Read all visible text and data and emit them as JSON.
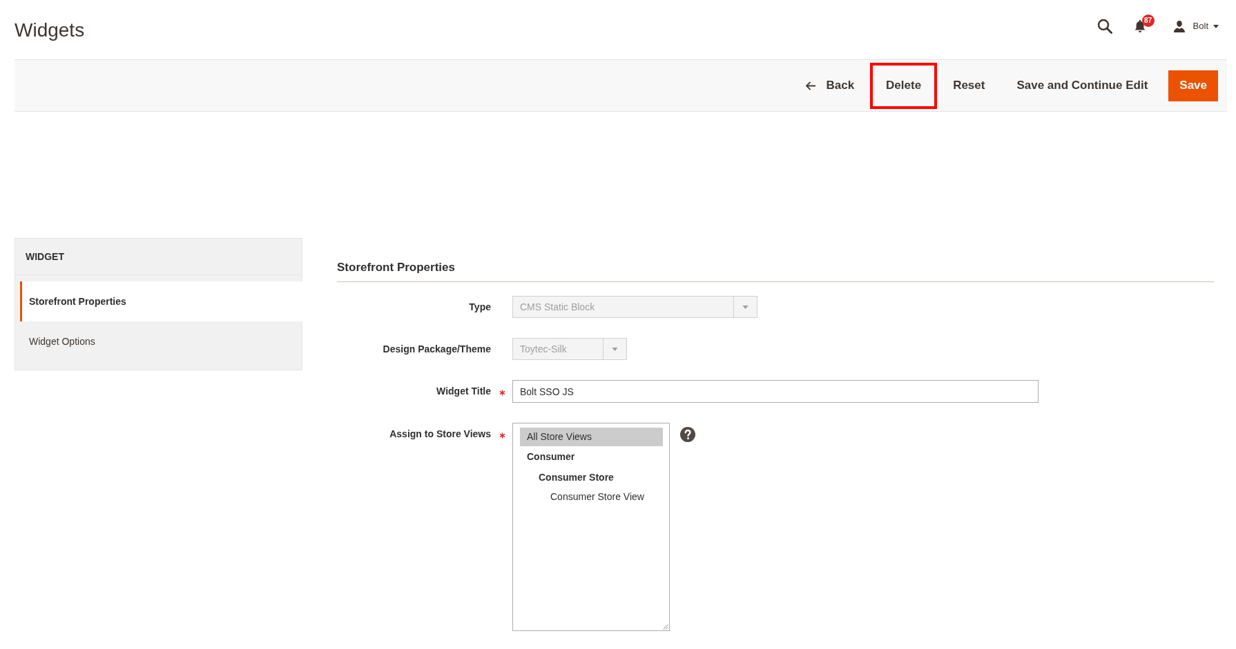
{
  "page_title": "Widgets",
  "header": {
    "notifications": "87",
    "user": "Bolt"
  },
  "actions": [
    {
      "kind": "back",
      "label": "Back",
      "highlighted": false
    },
    {
      "kind": "link",
      "label": "Delete",
      "highlighted": true
    },
    {
      "kind": "link",
      "label": "Reset",
      "highlighted": false
    },
    {
      "kind": "link",
      "label": "Save and Continue Edit",
      "highlighted": false
    },
    {
      "kind": "primary",
      "label": "Save",
      "highlighted": false
    }
  ],
  "sidebar": {
    "title": "WIDGET",
    "items": [
      {
        "label": "Storefront Properties",
        "selected": true
      },
      {
        "label": "Widget Options",
        "selected": false
      }
    ]
  },
  "section": {
    "title": "Storefront Properties",
    "fields": [
      {
        "kind": "select",
        "label": "Type",
        "value": "CMS Static Block",
        "disabled": true
      },
      {
        "kind": "select",
        "label": "Design Package/Theme",
        "value": "Toytec-Silk",
        "disabled": true
      },
      {
        "kind": "text",
        "label": "Widget Title",
        "value": "Bolt SSO JS",
        "required": true
      },
      {
        "kind": "multiselect",
        "label": "Assign to Store Views",
        "required": true,
        "help": true,
        "options": [
          {
            "kind": "option",
            "label": "All Store Views",
            "selected": true
          },
          {
            "kind": "group",
            "label": "Consumer",
            "selected": false,
            "children": [
              {
                "kind": "group",
                "label": "Consumer Store",
                "selected": false,
                "children": [
                  {
                    "kind": "option",
                    "label": "Consumer Store View",
                    "selected": false
                  }
                ]
              }
            ]
          }
        ]
      }
    ]
  }
}
